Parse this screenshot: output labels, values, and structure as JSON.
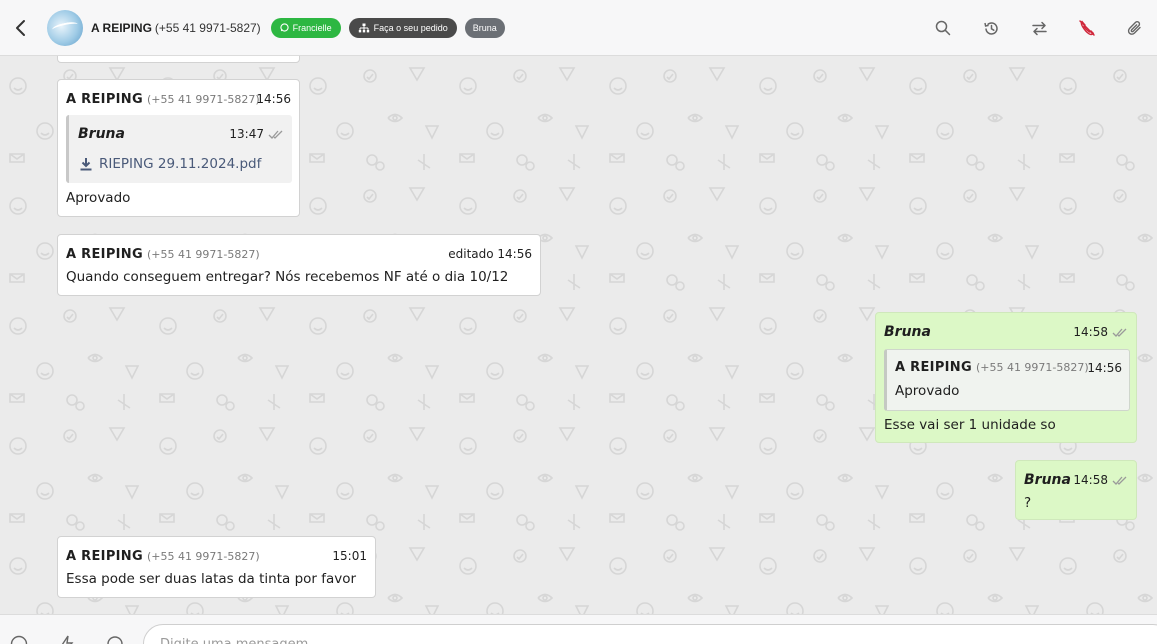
{
  "header": {
    "contact_name": "A REIPING",
    "contact_phone": "(+55 41 9971-5827)",
    "tags": [
      {
        "label": "Francielle",
        "color": "#2db742",
        "icon": "whatsapp-icon"
      },
      {
        "label": "Faça o seu pedido",
        "color": "#4a4a4a",
        "icon": "sitemap-icon"
      },
      {
        "label": "Bruna",
        "color": "#6b6f75"
      }
    ],
    "icons": [
      "search-icon",
      "history-icon",
      "transfer-icon",
      "finish-chat-icon",
      "attachment-icon"
    ]
  },
  "messages": [
    {
      "sender": "A REIPING",
      "phone": "(+55 41 9971-5827)",
      "time": "14:56",
      "quoted": {
        "sender": "Bruna",
        "time": "13:47",
        "file": "RIEPING 29.11.2024.pdf"
      },
      "text": "Aprovado"
    },
    {
      "sender": "A REIPING",
      "phone": "(+55 41 9971-5827)",
      "time": "editado 14:56",
      "text": "Quando conseguem entregar? Nós recebemos NF até o dia 10/12"
    },
    {
      "sender": "Bruna",
      "time": "14:58",
      "quoted": {
        "sender": "A REIPING",
        "phone": "(+55 41 9971-5827)",
        "time": "14:56",
        "text": "Aprovado"
      },
      "text": "Esse vai ser 1 unidade so"
    },
    {
      "sender": "Bruna",
      "time": "14:58",
      "text": "?"
    },
    {
      "sender": "A REIPING",
      "phone": "(+55 41 9971-5827)",
      "time": "15:01",
      "text": "Essa pode ser duas latas da tinta por favor"
    }
  ],
  "composer": {
    "placeholder": "Digite uma mensagem",
    "icons": [
      "emoji-icon",
      "quick-reply-icon",
      "record-icon"
    ]
  },
  "colors": {
    "tag_green": "#2db742",
    "outgoing_bubble": "#dcf8c6",
    "finish_icon": "#d0273b"
  }
}
